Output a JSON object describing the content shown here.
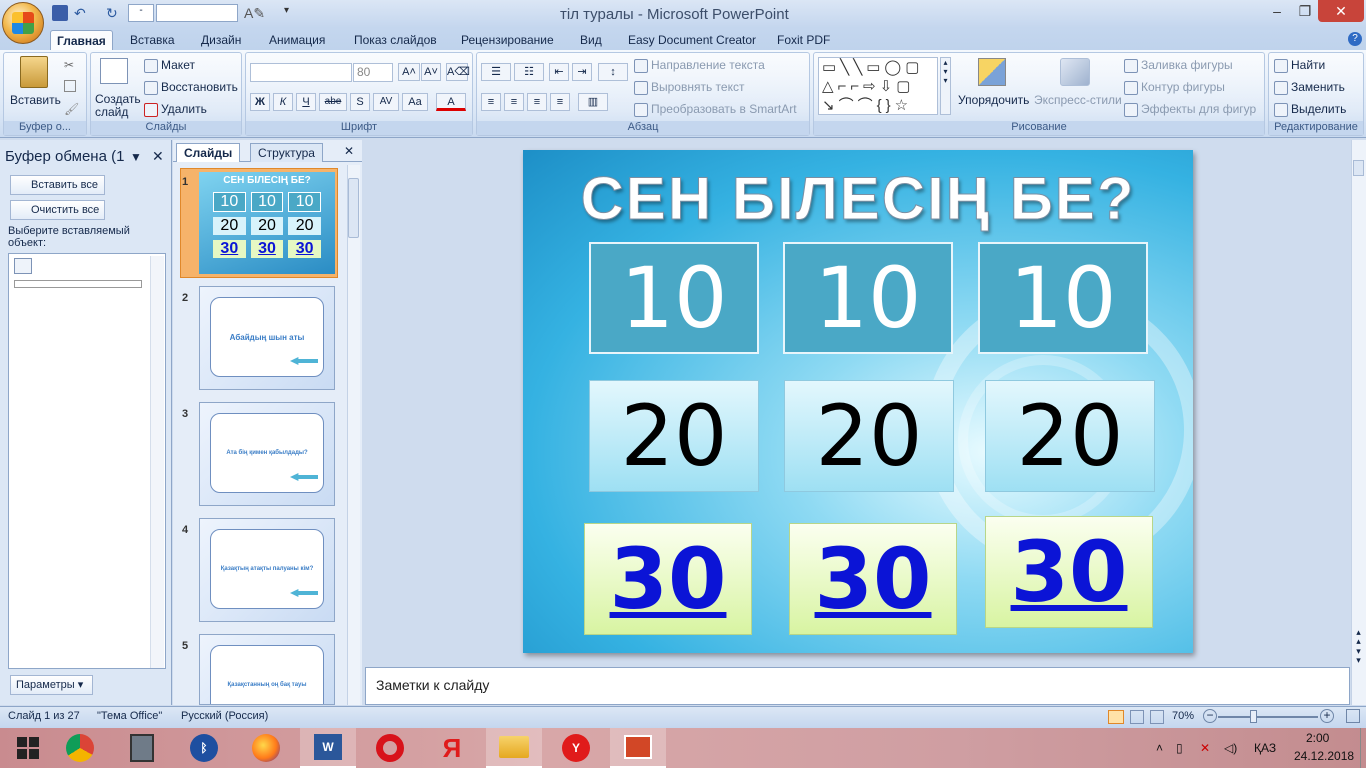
{
  "window": {
    "title": "тіл туралы - Microsoft PowerPoint",
    "qat_combo_value": "-"
  },
  "tabs": [
    "Главная",
    "Вставка",
    "Дизайн",
    "Анимация",
    "Показ слайдов",
    "Рецензирование",
    "Вид",
    "Easy Document Creator",
    "Foxit PDF"
  ],
  "ribbon": {
    "clipboard": {
      "paste": "Вставить",
      "label": "Буфер о..."
    },
    "slides": {
      "create": "Создать слайд",
      "layout": "Макет",
      "restore": "Восстановить",
      "delete": "Удалить",
      "label": "Слайды"
    },
    "font": {
      "size": "80",
      "bold": "Ж",
      "italic": "К",
      "underline": "Ч",
      "strike": "abe",
      "shadow": "S",
      "spacing": "AV",
      "case": "Aa",
      "color": "A",
      "label": "Шрифт"
    },
    "paragraph": {
      "text_direction": "Направление текста",
      "align_text": "Выровнять текст",
      "smartart": "Преобразовать в SmartArt",
      "label": "Абзац"
    },
    "drawing": {
      "arrange": "Упорядочить",
      "quick_styles": "Экспресс-стили",
      "fill": "Заливка фигуры",
      "outline": "Контур фигуры",
      "effects": "Эффекты для фигур",
      "label": "Рисование"
    },
    "editing": {
      "find": "Найти",
      "replace": "Заменить",
      "select": "Выделить",
      "label": "Редактирование"
    }
  },
  "clipboard_pane": {
    "title": "Буфер обмена (1",
    "paste_all": "Вставить все",
    "clear_all": "Очистить все",
    "hint": "Выберите вставляемый объект:",
    "params": "Параметры"
  },
  "slides_pane": {
    "tab_slides": "Слайды",
    "tab_outline": "Структура",
    "thumbnails": [
      {
        "num": "1",
        "text": ""
      },
      {
        "num": "2",
        "text": "Абайдың шын аты"
      },
      {
        "num": "3",
        "text": "Ата ​​бің қимен қабылдады?"
      },
      {
        "num": "4",
        "text": "Қазақтың атақты палуаны кім?"
      },
      {
        "num": "5",
        "text": "Қазақстанның оң бақ тауы"
      }
    ]
  },
  "slide": {
    "title": "СЕН БІЛЕСІҢ БЕ?",
    "row10": [
      "10",
      "10",
      "10"
    ],
    "row20": [
      "20",
      "20",
      "20"
    ],
    "row30": [
      "30",
      "30",
      "30"
    ],
    "thumb_title": "СЕН БІЛЕСІҢ БЕ?"
  },
  "notes_placeholder": "Заметки к слайду",
  "status": {
    "slide": "Слайд 1 из 27",
    "theme": "\"Тема Office\"",
    "language": "Русский (Россия)",
    "zoom": "70%"
  },
  "taskbar": {
    "lang": "ҚАЗ",
    "time": "2:00",
    "date": "24.12.2018"
  }
}
